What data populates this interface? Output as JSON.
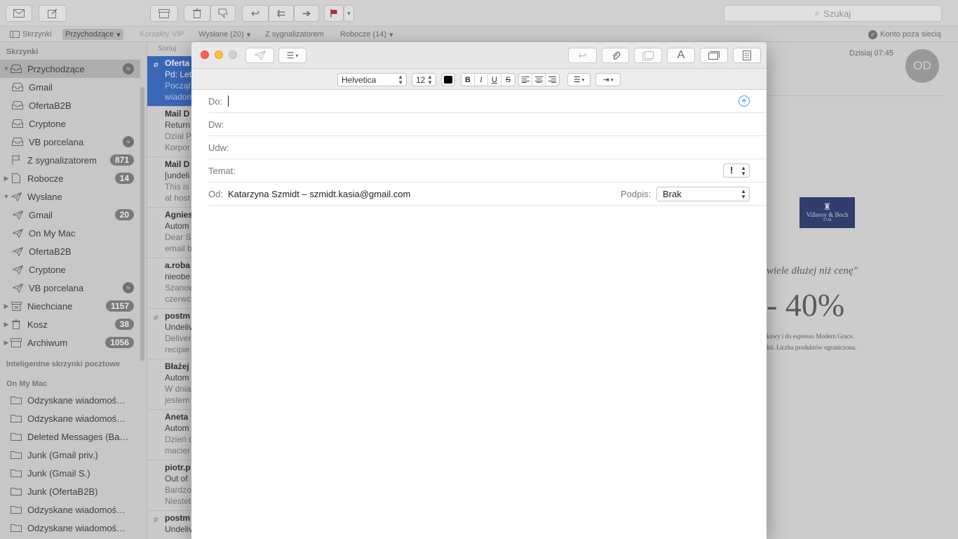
{
  "toolbar": {
    "search_placeholder": "Szukaj"
  },
  "favorites": {
    "mailboxes": "Skrzynki",
    "inbox": "Przychodzące",
    "vip": "Kontakty VIP",
    "sent": "Wysłane (20)",
    "flagged": "Z sygnalizatorem",
    "drafts": "Robocze (14)",
    "offline": "Konto poza siecią"
  },
  "sidebar": {
    "section_mailboxes": "Skrzynki",
    "inbox": "Przychodzące",
    "inbox_accounts": [
      "Gmail",
      "OfertaB2B",
      "Cryptone",
      "VB porcelana"
    ],
    "flagged": "Z sygnalizatorem",
    "flagged_count": "871",
    "drafts": "Robocze",
    "drafts_count": "14",
    "sent": "Wysłane",
    "sent_accounts": [
      "Gmail",
      "On My Mac",
      "OfertaB2B",
      "Cryptone",
      "VB porcelana"
    ],
    "sent_gmail_count": "20",
    "junk": "Niechciane",
    "junk_count": "1157",
    "trash": "Kosz",
    "trash_count": "38",
    "archive": "Archiwum",
    "archive_count": "1056",
    "section_smart": "Inteligentne skrzynki pocztowe",
    "section_onmymac": "On My Mac",
    "local_folders": [
      "Odzyskane wiadomoś…",
      "Odzyskane wiadomoś…",
      "Deleted Messages (Ba…",
      "Junk (Gmail priv.)",
      "Junk (Gmail S.)",
      "Junk (OfertaB2B)",
      "Odzyskane wiadomoś…",
      "Odzyskane wiadomoś…"
    ]
  },
  "message_list": {
    "sort_label": "Sortuj",
    "messages": [
      {
        "from": "Oferta",
        "subject": "Pd: Let",
        "preview1": "Począt",
        "preview2": "wiadom"
      },
      {
        "from": "Mail D",
        "subject": "Return",
        "preview1": "Dział P",
        "preview2": "Korpor"
      },
      {
        "from": "Mail D",
        "subject": "[undeli",
        "preview1": "This is",
        "preview2": "at host"
      },
      {
        "from": "Agnies",
        "subject": "Autom",
        "preview1": "Dear S",
        "preview2": "email b"
      },
      {
        "from": "a.roba",
        "subject": "nieobe",
        "preview1": "Szanow",
        "preview2": "czerwc"
      },
      {
        "from": "postm",
        "subject": "Undeliv",
        "preview1": "Deliver",
        "preview2": "recipie"
      },
      {
        "from": "Błażej",
        "subject": "Autom",
        "preview1": "W dnia",
        "preview2": "jestem"
      },
      {
        "from": "Aneta",
        "subject": "Autom",
        "preview1": "Dzień d",
        "preview2": "macier"
      },
      {
        "from": "piotr.p",
        "subject": "Out of",
        "preview1": "Bardzo",
        "preview2": "Niestet"
      },
      {
        "from": "postm",
        "subject": "Undeliv",
        "preview1": "",
        "preview2": ""
      }
    ]
  },
  "preview": {
    "date": "Dzisiaj 07:45",
    "avatar_initials": "OD",
    "logo_text": "Villeroy & Boch",
    "logo_year": "1748",
    "promo_line1": "wiele dłużej niż cenę\"",
    "promo_line2": "- 40%",
    "promo_line3": "kawy i do espresso Modern Grace.",
    "promo_line4": "lni. Liczba produktów ograniczona."
  },
  "compose": {
    "font_name": "Helvetica",
    "font_size": "12",
    "bold": "B",
    "italic": "I",
    "underline": "U",
    "strike": "S",
    "to_label": "Do:",
    "cc_label": "Dw:",
    "bcc_label": "Udw:",
    "subject_label": "Temat:",
    "priority_value": "!",
    "from_label": "Od:",
    "from_value": "Katarzyna Szmidt – szmidt.kasia@gmail.com",
    "signature_label": "Podpis:",
    "signature_value": "Brak"
  },
  "colors": {
    "selected_blue": "#2d63c4",
    "close_red": "#fc605c",
    "minimize_yellow": "#fdbc40",
    "add_recipient_blue": "#3a9ee8",
    "logo_navy": "#22306b"
  }
}
